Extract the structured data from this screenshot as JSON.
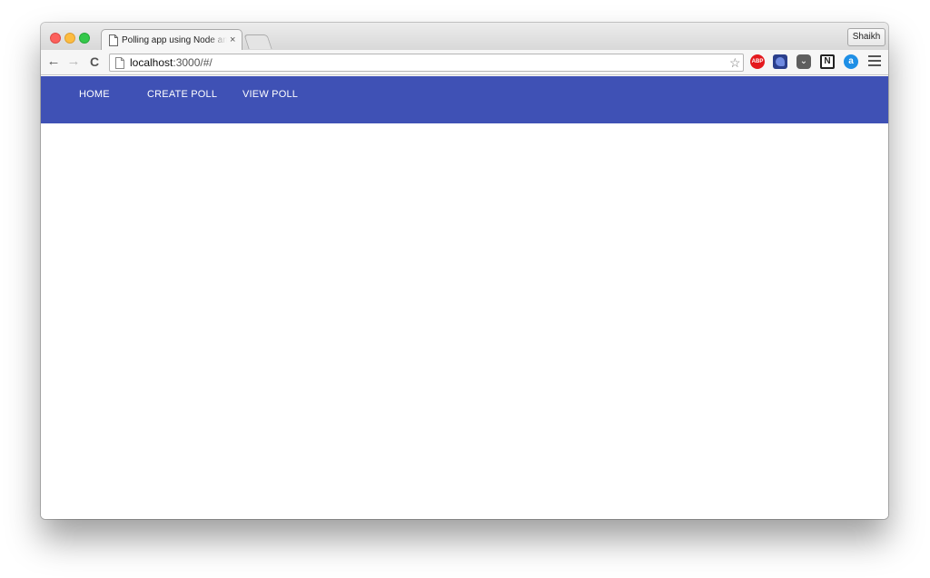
{
  "browser": {
    "tab": {
      "title": "Polling app using Node and Angular",
      "close_glyph": "×"
    },
    "profile_name": "Shaikh",
    "address": {
      "host": "localhost",
      "rest": ":3000/#/"
    },
    "icons": {
      "back": "←",
      "forward": "→",
      "reload": "C",
      "star": "☆",
      "extensions": {
        "abp": "ABP",
        "pocket": "⌄",
        "notion": "N",
        "amazon": "a"
      }
    },
    "colors": {
      "traffic_close": "#fc605c",
      "traffic_min": "#fdbc40",
      "traffic_max": "#34c84a"
    }
  },
  "app": {
    "navbar_color": "#3f51b5",
    "nav": {
      "home": "HOME",
      "create_poll": "CREATE POLL",
      "view_poll": "VIEW POLL"
    }
  }
}
